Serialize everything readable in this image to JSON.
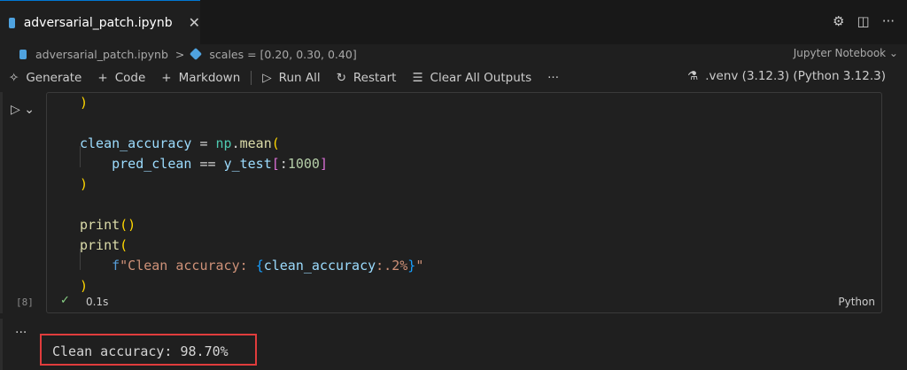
{
  "tab": {
    "label": "adversarial_patch.ipynb",
    "close": "✕"
  },
  "breadcrumb": {
    "file": "adversarial_patch.ipynb",
    "sep": ">",
    "symbol": "scales = [0.20, 0.30, 0.40]"
  },
  "kernel_type": "Jupyter Notebook ⌄",
  "toolbar": {
    "generate": "Generate",
    "code": "Code",
    "markdown": "Markdown",
    "run_all": "Run All",
    "restart": "Restart",
    "clear_outputs": "Clear All Outputs",
    "more": "···"
  },
  "kernel": ".venv (3.12.3) (Python 3.12.3)",
  "cell": {
    "exec_count": "[8]",
    "duration": "0.1s",
    "language": "Python",
    "code": {
      "line1_paren": ")",
      "var1": "clean_accuracy",
      "eq": " = ",
      "np": "np",
      "dot": ".",
      "mean": "mean",
      "open": "(",
      "pred": "pred_clean",
      "eqeq": " == ",
      "ytest": "y_test",
      "bopen": "[",
      "colon": ":",
      "num": "1000",
      "bclose": "]",
      "close": ")",
      "print": "print",
      "empty_call": "()",
      "fprefix": "f",
      "str1": "\"Clean accuracy: ",
      "brace_open": "{",
      "fvar": "clean_accuracy",
      "fmt": ":.2%",
      "brace_close": "}",
      "str2": "\""
    }
  },
  "output": {
    "dots": "...",
    "text": "Clean accuracy: 98.70%"
  },
  "colors": {
    "accent": "#0078d4",
    "highlight_box": "#e03c3c"
  }
}
